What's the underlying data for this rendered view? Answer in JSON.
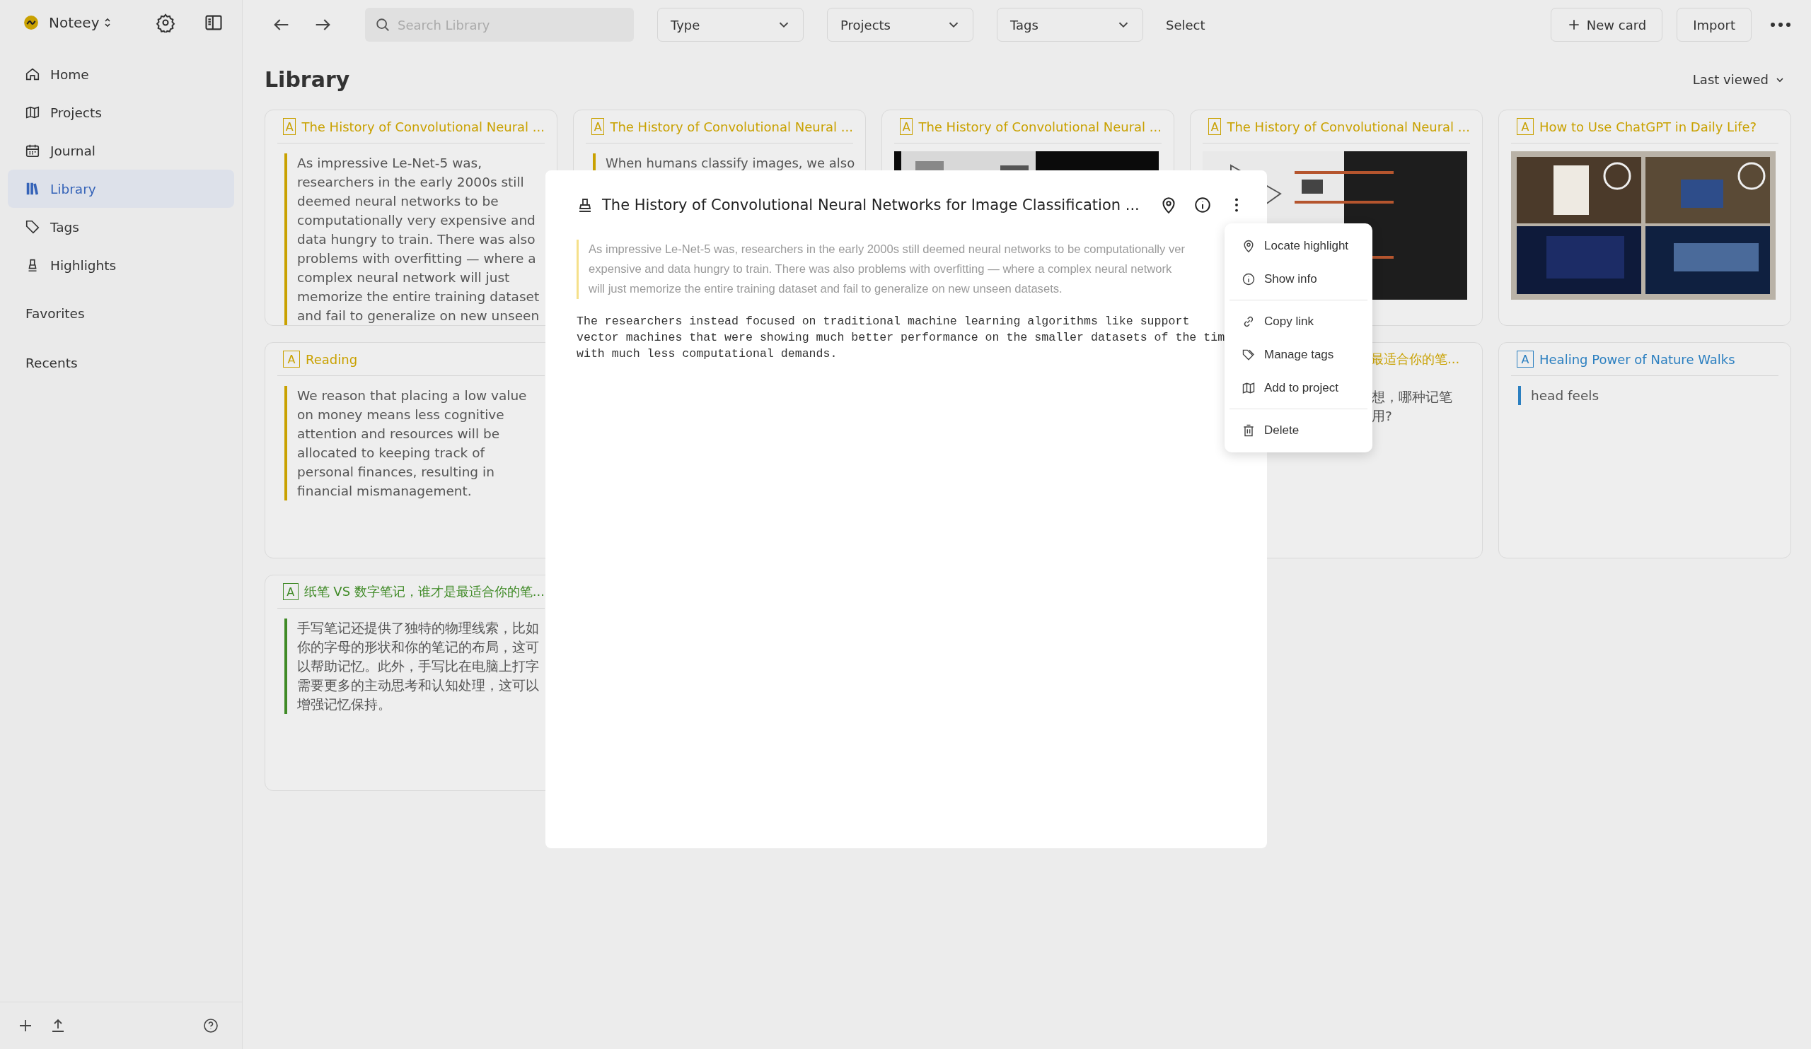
{
  "app": {
    "name": "Noteey"
  },
  "sidebar": {
    "nav": [
      {
        "kind": "home",
        "label": "Home",
        "selected": false
      },
      {
        "kind": "projects",
        "label": "Projects",
        "selected": false
      },
      {
        "kind": "journal",
        "label": "Journal",
        "selected": false
      },
      {
        "kind": "library",
        "label": "Library",
        "selected": true
      },
      {
        "kind": "tags",
        "label": "Tags",
        "selected": false
      },
      {
        "kind": "highlights",
        "label": "Highlights",
        "selected": false
      }
    ],
    "sections": [
      "Favorites",
      "Recents"
    ]
  },
  "toolbar": {
    "search": {
      "placeholder": "Search Library"
    },
    "filters": [
      "Type",
      "Projects",
      "Tags"
    ],
    "select": "Select",
    "new_card": "New card",
    "import": "Import"
  },
  "page": {
    "title": "Library",
    "sort": "Last viewed"
  },
  "columns": [
    [
      {
        "kind": "text",
        "type_label": "A",
        "title": "The History of Convolutional Neural ...",
        "color": "#c9a100",
        "body": "As impressive Le-Net-5 was, researchers in the early 2000s still deemed neural networks to be computationally very expensive and data hungry to train. There was also problems with overfitting — where a complex neural network will just memorize the entire training dataset and fail to generalize on new unseen"
      },
      {
        "kind": "text",
        "type_label": "A",
        "title": "Reading",
        "color": "#c9a100",
        "body": "We reason that placing a low value on money means less cognitive attention and resources will be allocated to keeping track of personal finances, resulting in financial mismanagement."
      },
      {
        "kind": "text",
        "type_label": "A",
        "title": "纸笔 VS 数字笔记，谁才是最适合你的笔...",
        "color": "#3f8a26",
        "body": "手写笔记还提供了独特的物理线索，比如你的字母的形状和你的笔记的布局，这可以帮助记忆。此外，手写比在电脑上打字需要更多的主动思考和认知处理，这可以增强记忆保持。"
      }
    ],
    [
      {
        "kind": "text",
        "type_label": "A",
        "title": "The History of Convolutional Neural ...",
        "color": "#c9a100",
        "body": "When humans classify images, we also"
      }
    ],
    [
      {
        "kind": "picture",
        "type_label": "A",
        "title": "The History of Convolutional Neural ...",
        "color": "#c9a100"
      }
    ],
    [
      {
        "kind": "picture",
        "type_label": "A",
        "title": "The History of Convolutional Neural ...",
        "color": "#c9a100"
      },
      {
        "kind": "fragment",
        "title": "最适合你的笔...",
        "color": "#c9a100",
        "lines": [
          "想，哪种记笔",
          "用?"
        ]
      }
    ],
    [
      {
        "kind": "picture",
        "type_label": "A",
        "title": "How to Use ChatGPT in Daily Life?",
        "color": "#c9a100"
      },
      {
        "kind": "text",
        "type_label": "A",
        "title": "Healing Power of Nature Walks",
        "color": "#2b7fc0",
        "body": "head feels"
      }
    ]
  ],
  "modal": {
    "title": "The History of Convolutional Neural Networks for Image Classification ...",
    "quote_lines": [
      "As impressive Le-Net-5 was, researchers in the early 2000s still deemed neural networks to be computationally ver",
      "expensive and data hungry to train. There was also problems with overfitting — where a complex neural network",
      "will just memorize the entire training dataset and fail to generalize on new unseen datasets."
    ],
    "paragraph_lines": [
      "The researchers instead focused on traditional machine learning algorithms like support",
      "vector machines that were showing much better performance on the smaller datasets of the tim",
      "with much less computational demands."
    ],
    "menu": [
      [
        {
          "kind": "locate",
          "label": "Locate highlight"
        },
        {
          "kind": "info",
          "label": "Show info"
        }
      ],
      [
        {
          "kind": "link",
          "label": "Copy link"
        },
        {
          "kind": "tags",
          "label": "Manage tags"
        },
        {
          "kind": "project",
          "label": "Add to project"
        }
      ],
      [
        {
          "kind": "delete",
          "label": "Delete"
        }
      ]
    ]
  }
}
